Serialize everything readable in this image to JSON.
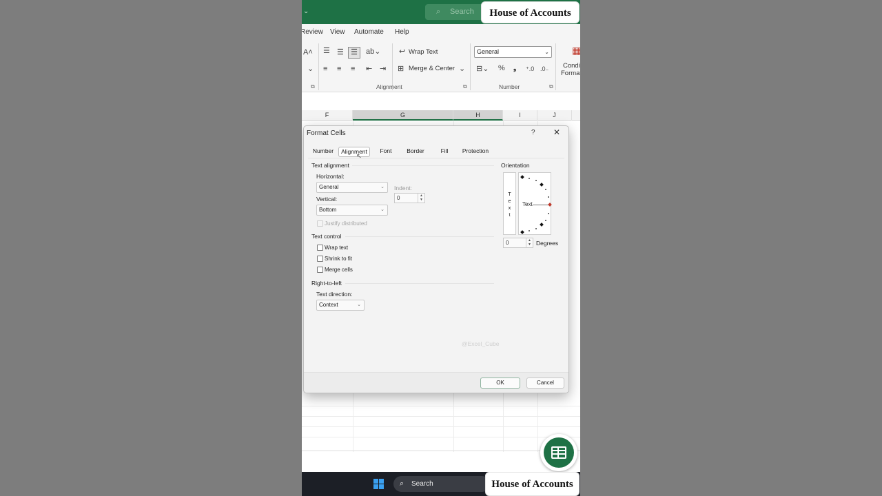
{
  "brand": {
    "top": "House of Accounts",
    "bottom": "House of Accounts"
  },
  "titlebar": {
    "search_placeholder": "Search",
    "accent_color": "#1e7145"
  },
  "menu": {
    "items": [
      "Review",
      "View",
      "Automate",
      "Help"
    ]
  },
  "ribbon": {
    "wrap_text": "Wrap Text",
    "merge_center": "Merge & Center",
    "number_format": "General",
    "alignment_group": "Alignment",
    "number_group": "Number",
    "conditional_line1": "Condi",
    "conditional_line2": "Format"
  },
  "sheet": {
    "columns": [
      "F",
      "G",
      "H",
      "I",
      "J"
    ],
    "selected_columns": [
      "G",
      "H"
    ]
  },
  "dialog": {
    "title": "Format Cells",
    "help": "?",
    "close": "✕",
    "tabs": [
      "Number",
      "Alignment",
      "Font",
      "Border",
      "Fill",
      "Protection"
    ],
    "active_tab": "Alignment",
    "text_alignment": {
      "section": "Text alignment",
      "horizontal_label": "Horizontal:",
      "horizontal_value": "General",
      "vertical_label": "Vertical:",
      "vertical_value": "Bottom",
      "indent_label": "Indent:",
      "indent_value": "0",
      "justify_distributed": "Justify distributed"
    },
    "text_control": {
      "section": "Text control",
      "wrap_text": "Wrap text",
      "shrink_to_fit": "Shrink to fit",
      "merge_cells": "Merge cells"
    },
    "rtl": {
      "section": "Right-to-left",
      "text_direction_label": "Text direction:",
      "text_direction_value": "Context"
    },
    "orientation": {
      "section": "Orientation",
      "vertical_text": [
        "T",
        "e",
        "x",
        "t"
      ],
      "dial_text": "Text",
      "degrees_value": "0",
      "degrees_label": "Degrees"
    },
    "watermark": "@Excel_Cube",
    "ok": "OK",
    "cancel": "Cancel"
  },
  "taskbar": {
    "search": "Search"
  }
}
